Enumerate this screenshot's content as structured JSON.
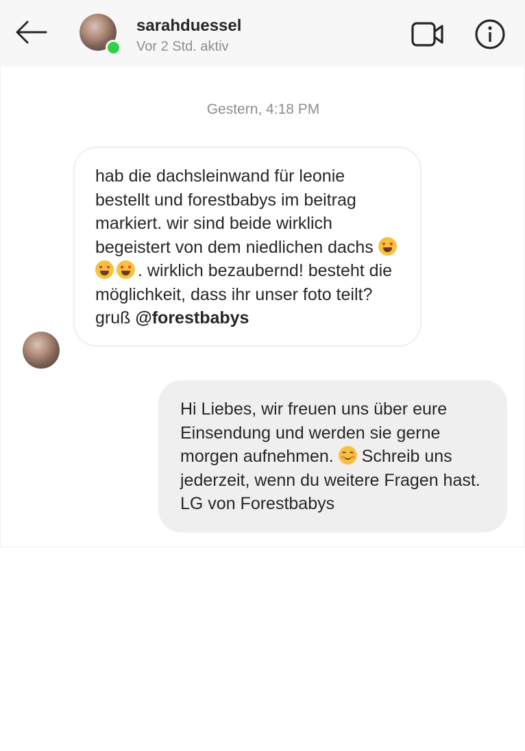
{
  "header": {
    "username": "sarahduessel",
    "status": "Vor 2 Std. aktiv",
    "back_icon": "arrow-left-icon",
    "video_icon": "video-camera-icon",
    "info_icon": "info-circle-icon",
    "online_color": "#2fd14a"
  },
  "chat": {
    "timestamp": "Gestern, 4:18 PM",
    "incoming": {
      "text_before_emoji": "hab die dachsleinwand für leonie bestellt und forestbabys im beitrag markiert. wir sind beide wirklich begeistert von dem niedlichen dachs ",
      "emoji": "heart-eyes-emoji",
      "emoji_count": 3,
      "text_after_emoji": ". wirklich bezaubernd! besteht die möglichkeit, dass ihr unser foto teilt? gruß ",
      "mention": "@forestbabys"
    },
    "outgoing": {
      "text_before_emoji": "Hi Liebes, wir freuen uns über eure Einsendung und werden sie gerne morgen aufnehmen. ",
      "emoji": "smiling-face-emoji",
      "text_after_emoji": " Schreib uns jederzeit, wenn du weitere Fragen hast. LG von Forestbabys"
    }
  }
}
